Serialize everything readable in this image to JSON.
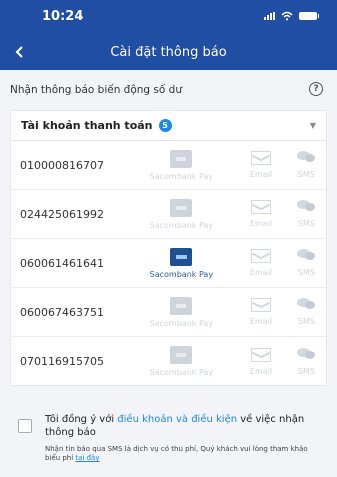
{
  "status": {
    "time": "10:24"
  },
  "nav": {
    "title": "Cài đặt thông báo"
  },
  "section": {
    "title": "Nhận thông báo biến động số dư",
    "help_symbol": "?"
  },
  "panel": {
    "title": "Tài khoản thanh toán",
    "badge_count": "5"
  },
  "accounts": [
    {
      "number": "010000816707",
      "pay_label": "Sacombank Pay",
      "email_label": "Email",
      "sms_label": "SMS"
    },
    {
      "number": "024425061992",
      "pay_label": "Sacombank Pay",
      "email_label": "Email",
      "sms_label": "SMS"
    },
    {
      "number": "060061461641",
      "pay_label": "Sacombank Pay",
      "email_label": "Email",
      "sms_label": "SMS"
    },
    {
      "number": "060067463751",
      "pay_label": "Sacombank Pay",
      "email_label": "Email",
      "sms_label": "SMS"
    },
    {
      "number": "070116915705",
      "pay_label": "Sacombank Pay",
      "email_label": "Email",
      "sms_label": "SMS"
    }
  ],
  "agreement": {
    "prefix": "Tôi đồng ý với ",
    "link": "điều khoản và điều kiện",
    "suffix": " về việc nhận thông báo",
    "note_prefix": "Nhận tin báo qua SMS là dịch vụ có thu phí, Quý khách vui lòng tham khảo biểu phí ",
    "note_link": "tại đây"
  },
  "colors": {
    "header": "#1f4ea3",
    "accent": "#1e88e5",
    "active_pay": "#1d4f91"
  }
}
